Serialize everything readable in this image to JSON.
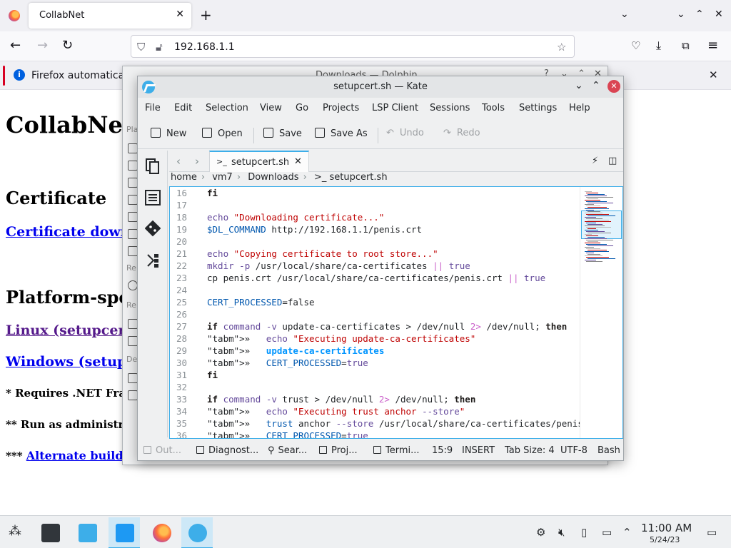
{
  "firefox": {
    "tab_title": "CollabNet",
    "url": "192.168.1.1",
    "notification": "Firefox automatically"
  },
  "webpage": {
    "title": "CollabNet",
    "h_certificate": "Certificate",
    "link_cert_download": "Certificate downl",
    "h_platform": "Platform-spec",
    "link_linux": "Linux (setupcert.",
    "link_windows": "Windows (setupc",
    "note1": "* Requires .NET Fra",
    "note2": "** Run as administra",
    "note3_prefix": "*** ",
    "note3_link": "Alternate build for"
  },
  "dolphin": {
    "title": "Downloads — Dolphin",
    "side_labels": [
      "Pla",
      "Re",
      "Re",
      "De"
    ]
  },
  "kate": {
    "title": "setupcert.sh — Kate",
    "menu": [
      "File",
      "Edit",
      "Selection",
      "View",
      "Go",
      "Projects",
      "LSP Client",
      "Sessions",
      "Tools",
      "Settings",
      "Help"
    ],
    "toolbar": {
      "new": "New",
      "open": "Open",
      "save": "Save",
      "save_as": "Save As",
      "undo": "Undo",
      "redo": "Redo"
    },
    "tab": {
      "label": "setupcert.sh",
      "icon": ">_"
    },
    "breadcrumb": [
      "home",
      "vm7",
      "Downloads",
      ">_ setupcert.sh"
    ],
    "code": {
      "line_numbers": [
        "16",
        "17",
        "18",
        "19",
        "20",
        "21",
        "22",
        "23",
        "24",
        "25",
        "26",
        "27",
        "28",
        "29",
        "30",
        "31",
        "32",
        "33",
        "34",
        "35",
        "36"
      ],
      "lines": [
        "fi",
        "",
        "echo \"Downloading certificate...\"",
        "$DL_COMMAND http://192.168.1.1/penis.crt",
        "",
        "echo \"Copying certificate to root store...\"",
        "mkdir -p /usr/local/share/ca-certificates || true",
        "cp penis.crt /usr/local/share/ca-certificates/penis.crt || true",
        "",
        "CERT_PROCESSED=false",
        "",
        "if command -v update-ca-certificates > /dev/null 2> /dev/null; then",
        "»   echo \"Executing update-ca-certificates\"",
        "»   update-ca-certificates",
        "»   CERT_PROCESSED=true",
        "fi",
        "",
        "if command -v trust > /dev/null 2> /dev/null; then",
        "»   echo \"Executing trust anchor --store\"",
        "»   trust anchor --store /usr/local/share/ca-certificates/penis.crt",
        "»   CERT_PROCESSED=true"
      ]
    },
    "status": {
      "output": "Out...",
      "diagnostics": "Diagnost...",
      "search": "Sear...",
      "projects": "Proj...",
      "terminal": "Termi...",
      "position": "15:9",
      "mode": "INSERT",
      "tab_size": "Tab Size: 4",
      "encoding": "UTF-8",
      "language": "Bash"
    }
  },
  "taskbar": {
    "time": "11:00 AM",
    "date": "5/24/23"
  },
  "colors": {
    "accent": "#3daee9",
    "close_red": "#da4453",
    "link_blue": "#0000ee",
    "visited": "#551a8b"
  }
}
